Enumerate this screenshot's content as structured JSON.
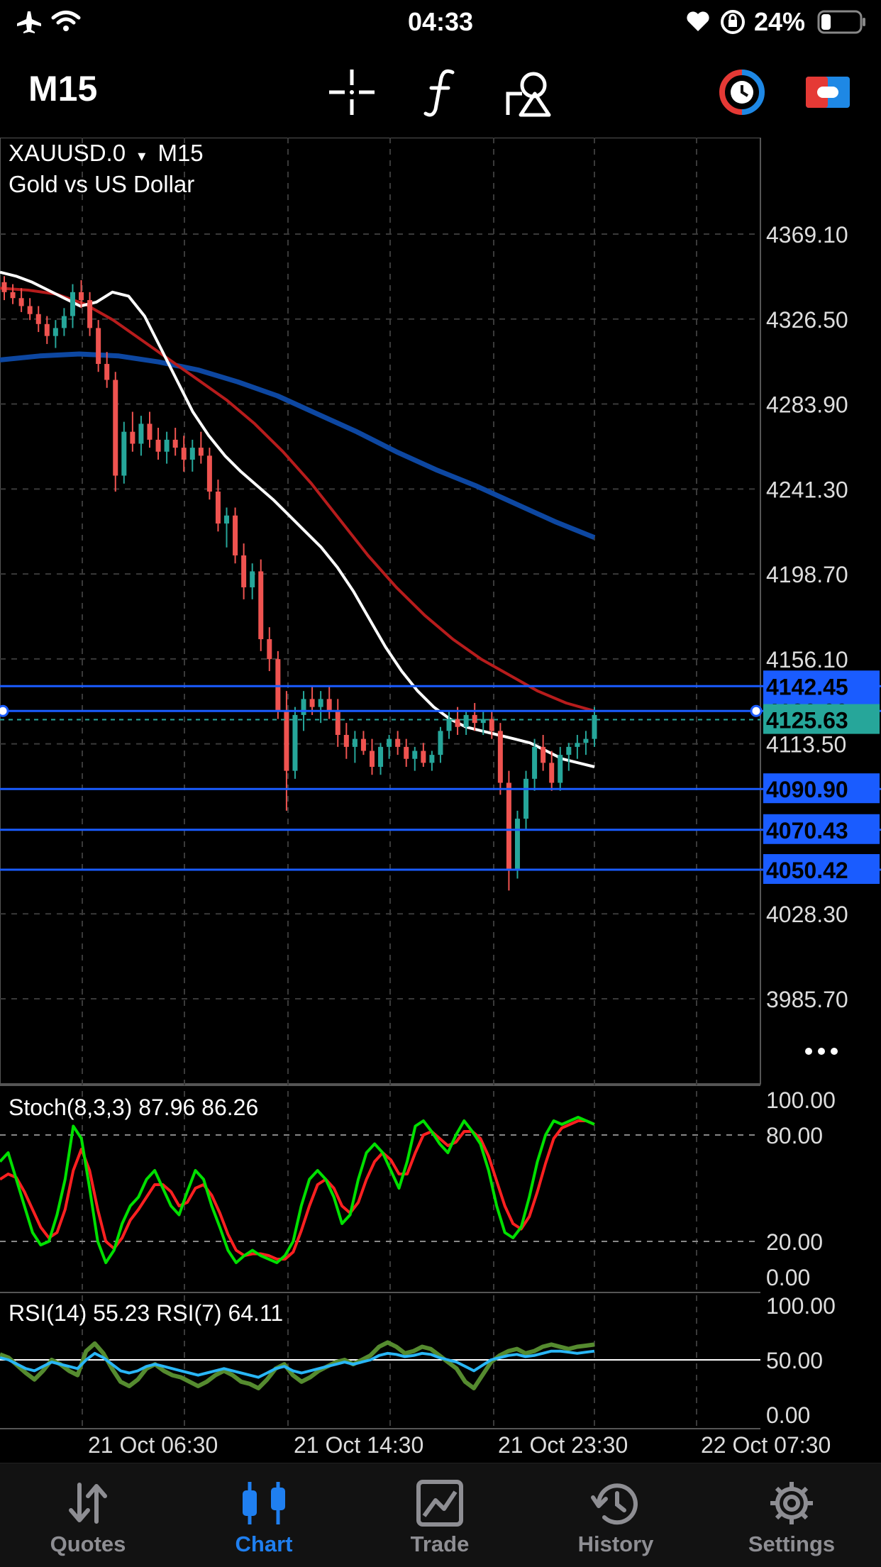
{
  "status_bar": {
    "time": "04:33",
    "battery": "24%"
  },
  "toolbar": {
    "timeframe": "M15",
    "tools": [
      {
        "icon": "crosshair-icon"
      },
      {
        "icon": "function-icon"
      },
      {
        "icon": "objects-icon"
      },
      {
        "icon": "one-click-trading-icon"
      },
      {
        "icon": "toggle-icon"
      }
    ]
  },
  "chart": {
    "symbol": "XAUUSD.0",
    "period": "M15",
    "description": "Gold vs US Dollar",
    "more_icon": "ellipsis-icon",
    "price_axis": [
      "4369.10",
      "4326.50",
      "4283.90",
      "4241.30",
      "4198.70",
      "4156.10",
      "4113.50",
      "4028.30",
      "3985.70"
    ],
    "levels": [
      {
        "label": "4142.45",
        "value": 4142.45
      },
      {
        "label": "4130.00",
        "value": 4130.0
      },
      {
        "label": "4090.90",
        "value": 4090.9
      },
      {
        "label": "4070.43",
        "value": 4070.43
      },
      {
        "label": "4050.42",
        "value": 4050.42
      }
    ],
    "bid": {
      "label": "4125.63",
      "value": 4125.63
    },
    "time_axis": [
      "21 Oct 06:30",
      "21 Oct 14:30",
      "21 Oct 23:30",
      "22 Oct 07:30"
    ],
    "colors": {
      "bull": "#26a69a",
      "bear": "#ef5350",
      "level": "#1a5cff",
      "ma_fast": "#ffffff",
      "ma_mid": "#b71c1c",
      "ma_slow": "#0d47a1"
    }
  },
  "stoch": {
    "label": "Stoch(8,3,3) 87.96 86.26",
    "axis": [
      "100.00",
      "80.00",
      "20.00",
      "0.00"
    ],
    "colors": {
      "main": "#00e000",
      "signal": "#ff2020"
    }
  },
  "rsi": {
    "label": "RSI(14) 55.23 RSI(7) 64.11",
    "axis": [
      "100.00",
      "50.00",
      "0.00"
    ],
    "colors": {
      "rsi14": "#29b6f6",
      "rsi7": "#558b2f"
    }
  },
  "chart_data": {
    "type": "candlestick",
    "ylim": [
      3960,
      4400
    ],
    "candles": [
      [
        4345,
        4348,
        4336,
        4340
      ],
      [
        4340,
        4344,
        4334,
        4337
      ],
      [
        4337,
        4342,
        4330,
        4333
      ],
      [
        4333,
        4337,
        4326,
        4329
      ],
      [
        4329,
        4333,
        4320,
        4324
      ],
      [
        4324,
        4328,
        4314,
        4318
      ],
      [
        4318,
        4326,
        4312,
        4322
      ],
      [
        4322,
        4332,
        4318,
        4328
      ],
      [
        4328,
        4344,
        4322,
        4340
      ],
      [
        4340,
        4346,
        4332,
        4336
      ],
      [
        4336,
        4340,
        4318,
        4322
      ],
      [
        4322,
        4326,
        4300,
        4304
      ],
      [
        4304,
        4310,
        4292,
        4296
      ],
      [
        4296,
        4300,
        4240,
        4248
      ],
      [
        4248,
        4275,
        4244,
        4270
      ],
      [
        4270,
        4280,
        4260,
        4264
      ],
      [
        4264,
        4278,
        4258,
        4274
      ],
      [
        4274,
        4280,
        4262,
        4266
      ],
      [
        4266,
        4272,
        4256,
        4260
      ],
      [
        4260,
        4270,
        4254,
        4266
      ],
      [
        4266,
        4272,
        4258,
        4262
      ],
      [
        4262,
        4268,
        4250,
        4256
      ],
      [
        4256,
        4266,
        4250,
        4262
      ],
      [
        4262,
        4270,
        4254,
        4258
      ],
      [
        4258,
        4262,
        4236,
        4240
      ],
      [
        4240,
        4246,
        4220,
        4224
      ],
      [
        4224,
        4232,
        4212,
        4228
      ],
      [
        4228,
        4232,
        4204,
        4208
      ],
      [
        4208,
        4214,
        4186,
        4192
      ],
      [
        4192,
        4204,
        4186,
        4200
      ],
      [
        4200,
        4206,
        4160,
        4166
      ],
      [
        4166,
        4172,
        4150,
        4156
      ],
      [
        4156,
        4160,
        4126,
        4130
      ],
      [
        4130,
        4140,
        4080,
        4100
      ],
      [
        4100,
        4132,
        4096,
        4128
      ],
      [
        4128,
        4140,
        4120,
        4136
      ],
      [
        4136,
        4142,
        4128,
        4132
      ],
      [
        4132,
        4140,
        4124,
        4136
      ],
      [
        4136,
        4142,
        4126,
        4130
      ],
      [
        4130,
        4136,
        4112,
        4118
      ],
      [
        4118,
        4124,
        4106,
        4112
      ],
      [
        4112,
        4120,
        4104,
        4116
      ],
      [
        4116,
        4120,
        4108,
        4110
      ],
      [
        4110,
        4116,
        4098,
        4102
      ],
      [
        4102,
        4114,
        4098,
        4112
      ],
      [
        4112,
        4118,
        4106,
        4116
      ],
      [
        4116,
        4120,
        4108,
        4112
      ],
      [
        4112,
        4116,
        4102,
        4106
      ],
      [
        4106,
        4112,
        4100,
        4110
      ],
      [
        4110,
        4114,
        4102,
        4104
      ],
      [
        4104,
        4110,
        4100,
        4108
      ],
      [
        4108,
        4122,
        4104,
        4120
      ],
      [
        4120,
        4130,
        4116,
        4126
      ],
      [
        4126,
        4132,
        4118,
        4122
      ],
      [
        4122,
        4130,
        4118,
        4128
      ],
      [
        4128,
        4134,
        4120,
        4124
      ],
      [
        4124,
        4130,
        4118,
        4126
      ],
      [
        4126,
        4130,
        4116,
        4120
      ],
      [
        4120,
        4124,
        4088,
        4094
      ],
      [
        4094,
        4100,
        4040,
        4050
      ],
      [
        4050,
        4080,
        4046,
        4076
      ],
      [
        4076,
        4100,
        4070,
        4096
      ],
      [
        4096,
        4116,
        4090,
        4112
      ],
      [
        4112,
        4118,
        4100,
        4104
      ],
      [
        4104,
        4110,
        4090,
        4094
      ],
      [
        4094,
        4112,
        4090,
        4108
      ],
      [
        4108,
        4114,
        4100,
        4112
      ],
      [
        4112,
        4118,
        4106,
        4114
      ],
      [
        4114,
        4120,
        4108,
        4116
      ],
      [
        4116,
        4132,
        4112,
        4128
      ]
    ],
    "ma_fast": [
      4350,
      4348,
      4345,
      4341,
      4337,
      4333,
      4335,
      4340,
      4338,
      4328,
      4312,
      4296,
      4280,
      4268,
      4258,
      4250,
      4243,
      4236,
      4228,
      4220,
      4212,
      4202,
      4190,
      4176,
      4162,
      4150,
      4140,
      4132,
      4126,
      4122,
      4120,
      4118,
      4116,
      4114,
      4110,
      4106,
      4104,
      4102
    ],
    "ma_mid": [
      4342,
      4341,
      4339,
      4334,
      4326,
      4316,
      4306,
      4296,
      4286,
      4274,
      4260,
      4244,
      4226,
      4208,
      4192,
      4178,
      4166,
      4156,
      4148,
      4140,
      4134,
      4130
    ],
    "ma_slow": [
      4306,
      4308,
      4309,
      4308,
      4305,
      4301,
      4295,
      4288,
      4279,
      4270,
      4260,
      4251,
      4243,
      4234,
      4225,
      4217
    ],
    "stoch_main": [
      65,
      70,
      55,
      40,
      25,
      18,
      20,
      35,
      55,
      85,
      78,
      50,
      20,
      8,
      15,
      30,
      40,
      45,
      55,
      60,
      50,
      40,
      35,
      48,
      60,
      55,
      40,
      28,
      15,
      8,
      12,
      15,
      12,
      10,
      8,
      12,
      20,
      40,
      55,
      60,
      55,
      45,
      30,
      35,
      55,
      70,
      75,
      70,
      60,
      50,
      65,
      85,
      88,
      82,
      75,
      70,
      80,
      88,
      82,
      75,
      60,
      40,
      25,
      22,
      28,
      45,
      65,
      80,
      88,
      86,
      88,
      90,
      88,
      86
    ],
    "stoch_signal": [
      55,
      58,
      56,
      48,
      38,
      28,
      22,
      25,
      38,
      60,
      72,
      60,
      38,
      20,
      16,
      22,
      32,
      38,
      45,
      52,
      52,
      48,
      40,
      42,
      50,
      52,
      46,
      36,
      24,
      15,
      12,
      13,
      13,
      12,
      10,
      10,
      14,
      26,
      40,
      52,
      55,
      50,
      40,
      36,
      42,
      55,
      65,
      70,
      66,
      58,
      58,
      70,
      80,
      82,
      78,
      74,
      76,
      82,
      82,
      78,
      68,
      54,
      40,
      30,
      27,
      34,
      48,
      64,
      78,
      84,
      86,
      88,
      88,
      86
    ],
    "rsi14": [
      52,
      50,
      46,
      42,
      40,
      44,
      48,
      46,
      44,
      42,
      50,
      56,
      52,
      46,
      40,
      38,
      40,
      44,
      46,
      44,
      42,
      40,
      38,
      36,
      38,
      40,
      42,
      40,
      38,
      36,
      34,
      38,
      42,
      44,
      40,
      38,
      40,
      42,
      44,
      46,
      48,
      46,
      48,
      50,
      54,
      56,
      55,
      53,
      54,
      56,
      55,
      52,
      50,
      48,
      44,
      40,
      45,
      50,
      52,
      54,
      55,
      53,
      54,
      56,
      58,
      58,
      57,
      56,
      57,
      58
    ],
    "rsi7": [
      55,
      52,
      45,
      38,
      32,
      40,
      50,
      46,
      40,
      36,
      58,
      65,
      56,
      42,
      30,
      26,
      32,
      42,
      46,
      40,
      36,
      34,
      30,
      26,
      30,
      36,
      40,
      36,
      30,
      28,
      24,
      32,
      42,
      46,
      36,
      30,
      34,
      40,
      44,
      48,
      50,
      46,
      50,
      54,
      62,
      66,
      62,
      56,
      58,
      62,
      60,
      54,
      48,
      42,
      30,
      24,
      36,
      48,
      54,
      58,
      60,
      56,
      58,
      62,
      64,
      62,
      60,
      62,
      63,
      64
    ]
  }
}
